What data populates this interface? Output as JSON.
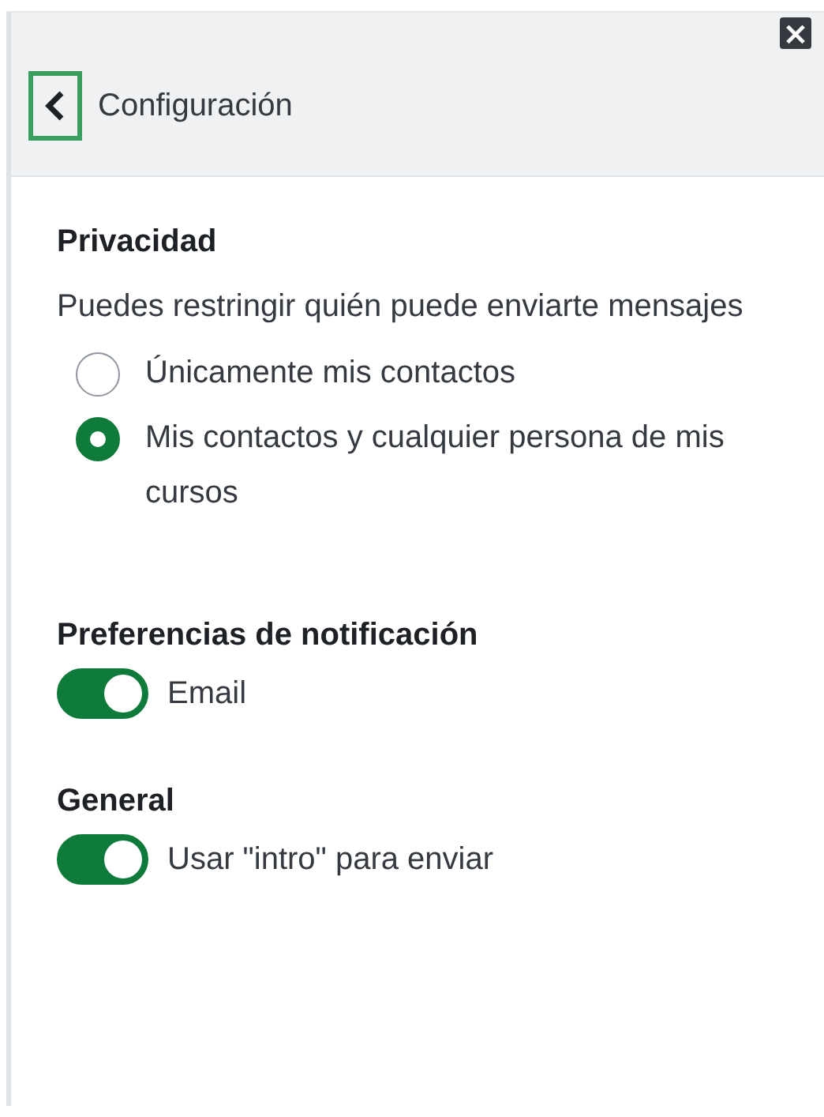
{
  "header": {
    "title": "Configuración",
    "close_label": "×"
  },
  "sections": [
    {
      "kind": "radios",
      "title": "Privacidad",
      "description": "Puedes restringir quién puede enviarte mensajes",
      "options": [
        {
          "label": "Únicamente mis contactos",
          "selected": false
        },
        {
          "label": "Mis contactos y cualquier persona de mis cursos",
          "selected": true
        }
      ]
    },
    {
      "kind": "toggles",
      "title": "Preferencias de notificación",
      "toggles": [
        {
          "label": "Email",
          "on": true
        }
      ]
    },
    {
      "kind": "toggles",
      "title": "General",
      "toggles": [
        {
          "label": "Usar \"intro\" para enviar",
          "on": true
        }
      ]
    }
  ]
}
